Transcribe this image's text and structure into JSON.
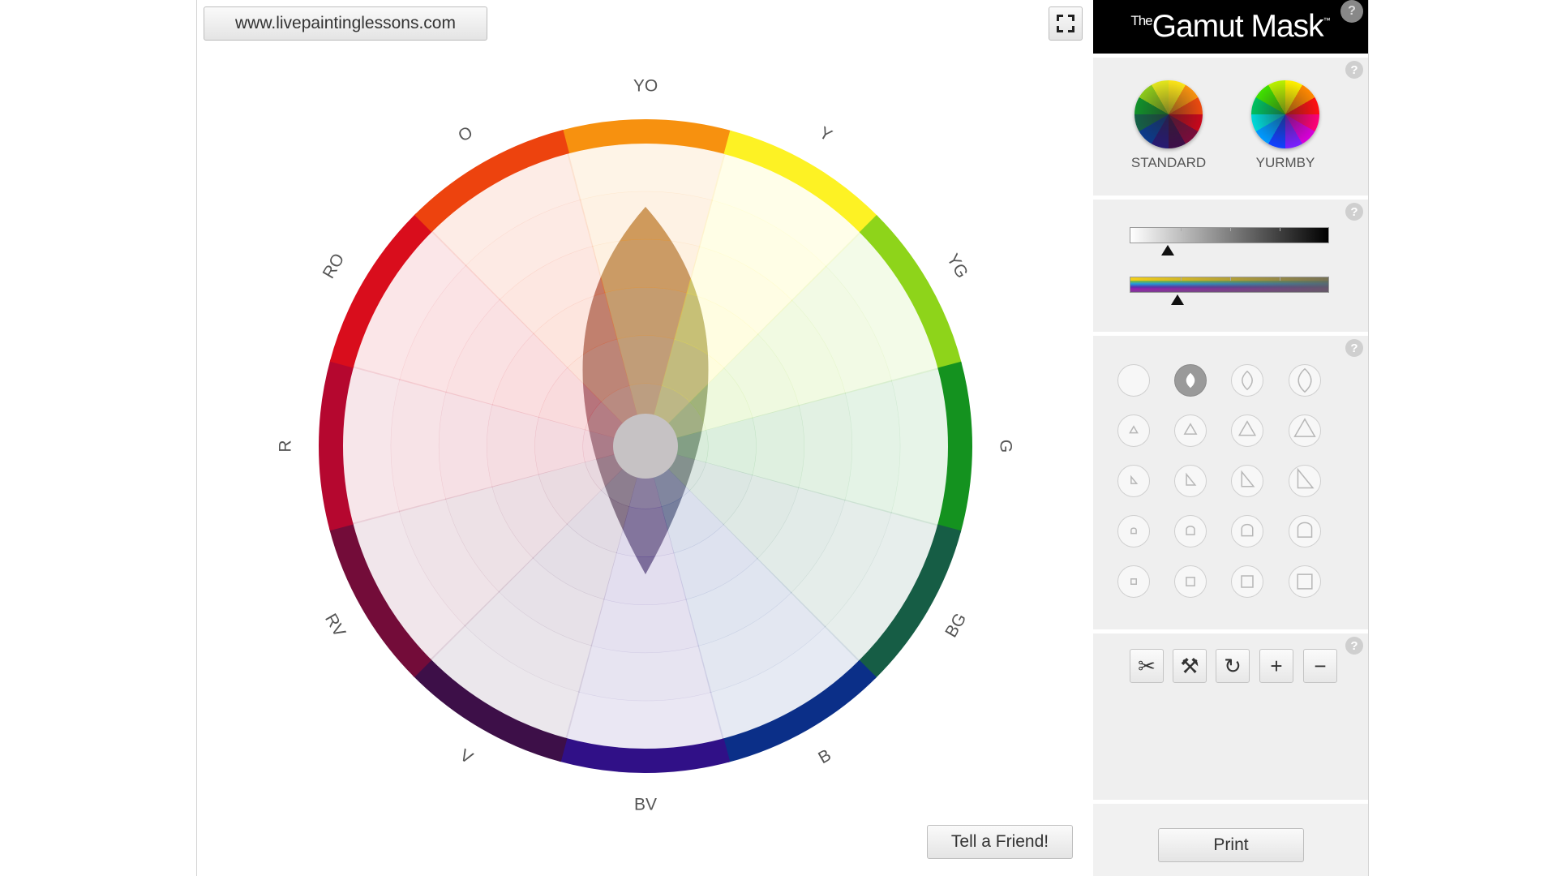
{
  "canvas": {
    "url_label": "www.livepaintinglessons.com",
    "tell_friend_label": "Tell a Friend!",
    "fullscreen_icon": "fullscreen-icon"
  },
  "wheel": {
    "hue_labels": [
      "YO",
      "Y",
      "YG",
      "G",
      "BG",
      "B",
      "BV",
      "V",
      "RV",
      "R",
      "RO",
      "O"
    ],
    "hue_colors": [
      "#f7910f",
      "#fdf224",
      "#8ed41a",
      "#14921f",
      "#165d45",
      "#0b2f88",
      "#301087",
      "#3d0f48",
      "#730c39",
      "#b5072f",
      "#d90d1c",
      "#ed430e"
    ],
    "mask_shape": "lens"
  },
  "panel": {
    "app_title_small": "The",
    "app_title": "Gamut Mask",
    "app_title_tm": "™",
    "help_label": "?",
    "wheel_types": [
      {
        "label": "STANDARD",
        "colors": [
          "#fbe318",
          "#f7910f",
          "#ec4a0e",
          "#c8071b",
          "#7a0c3b",
          "#3d0f48",
          "#271a72",
          "#0c3a8b",
          "#156047",
          "#12912a",
          "#8cc91a",
          "#e2e51c"
        ]
      },
      {
        "label": "YURMBY",
        "colors": [
          "#fff000",
          "#ff8800",
          "#ff1010",
          "#ff0077",
          "#d800d8",
          "#7a20ff",
          "#1040ff",
          "#0099ff",
          "#00d8d8",
          "#00c060",
          "#40e000",
          "#b8f000"
        ]
      }
    ],
    "sliders": {
      "value": {
        "thumb_fraction": 0.19
      },
      "saturation": {
        "thumb_fraction": 0.24
      }
    },
    "shape_rows": [
      "circle",
      "triangle",
      "right-triangle",
      "tombstone",
      "square"
    ],
    "tools": [
      {
        "name": "cut-tool-button",
        "icon": "scissors-icon",
        "glyph": "✂"
      },
      {
        "name": "paint-tool-button",
        "icon": "paint-bucket-icon",
        "glyph": "⚒"
      },
      {
        "name": "rotate-tool-button",
        "icon": "rotate-icon",
        "glyph": "↻"
      },
      {
        "name": "zoom-in-button",
        "icon": "plus-icon",
        "glyph": "+"
      },
      {
        "name": "zoom-out-button",
        "icon": "minus-icon",
        "glyph": "−"
      }
    ],
    "print_label": "Print"
  }
}
